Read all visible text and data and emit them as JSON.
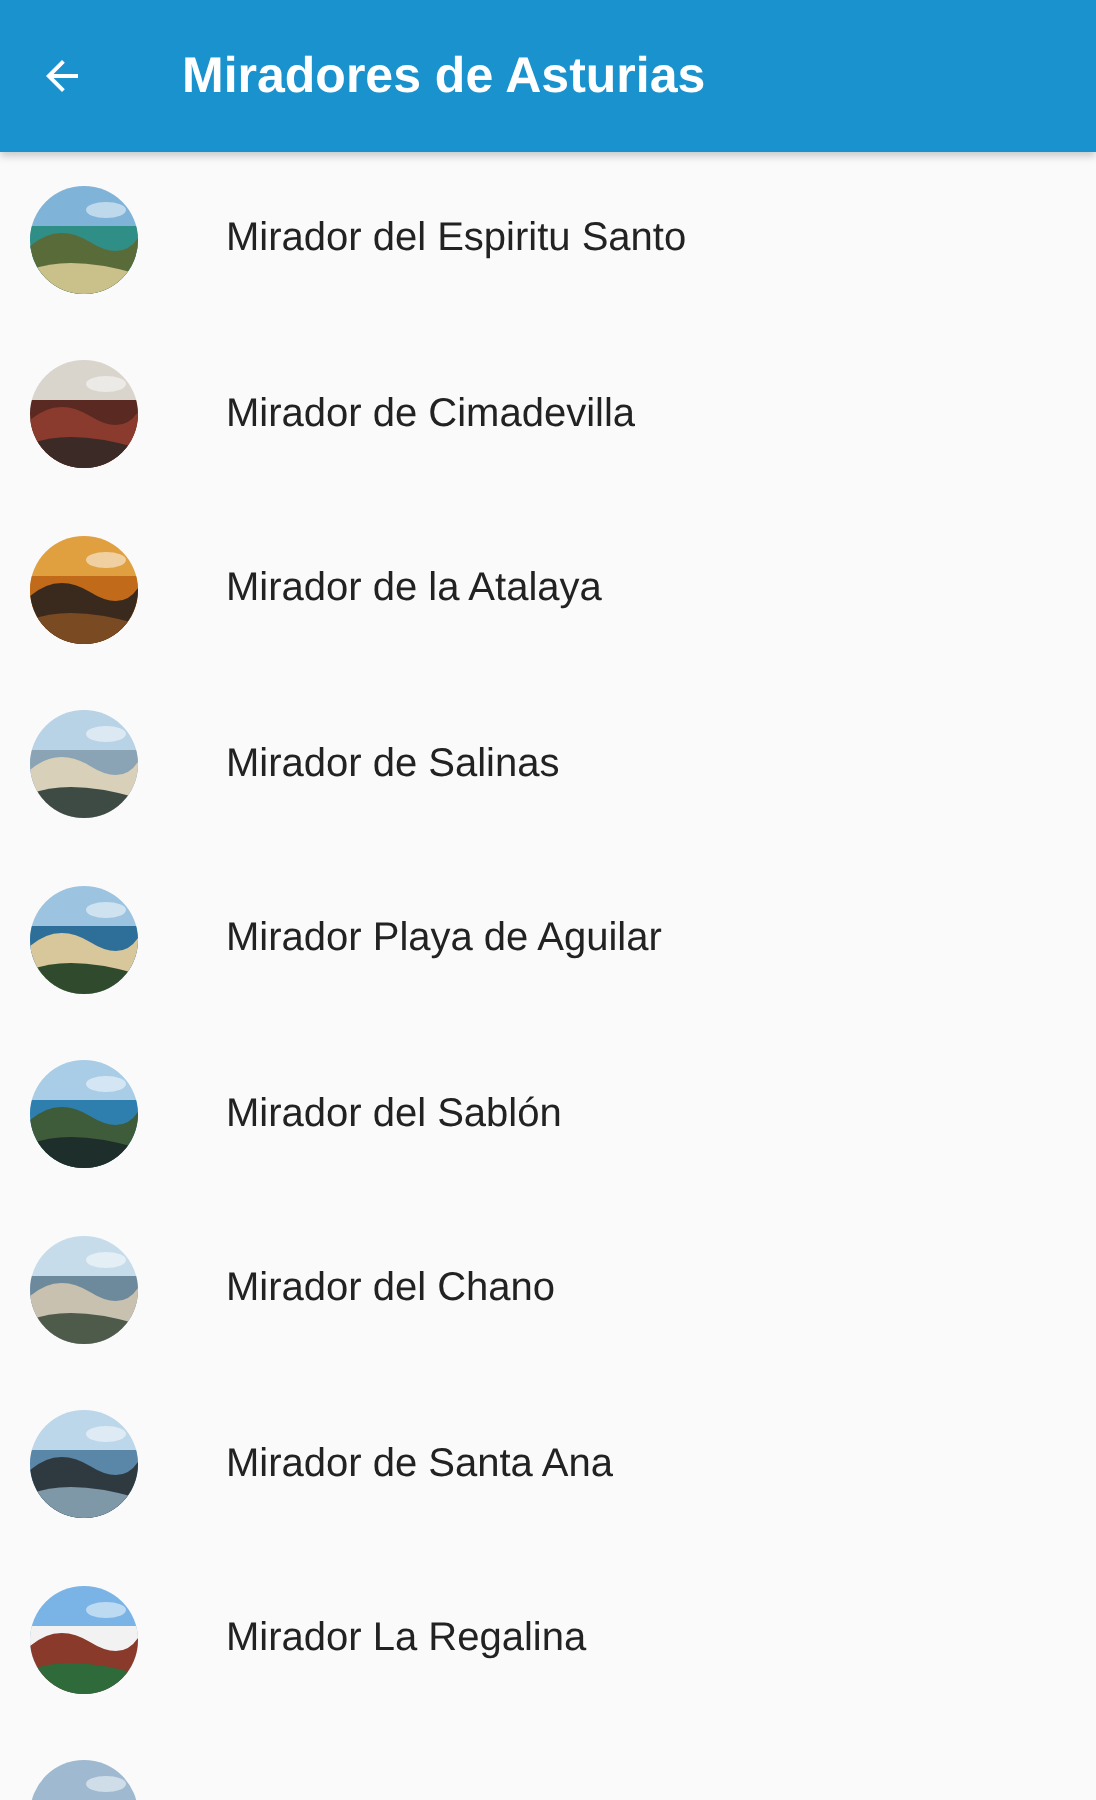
{
  "app_bar": {
    "title": "Miradores de Asturias"
  },
  "items": [
    {
      "label": "Mirador del Espiritu Santo",
      "thumbnail": {
        "kind": "picture"
      }
    },
    {
      "label": "Mirador de Cimadevilla",
      "thumbnail": {
        "kind": "picture"
      }
    },
    {
      "label": "Mirador de la Atalaya",
      "thumbnail": {
        "kind": "picture"
      }
    },
    {
      "label": "Mirador de Salinas",
      "thumbnail": {
        "kind": "picture"
      }
    },
    {
      "label": "Mirador Playa de Aguilar",
      "thumbnail": {
        "kind": "picture"
      }
    },
    {
      "label": "Mirador del Sablón",
      "thumbnail": {
        "kind": "picture"
      }
    },
    {
      "label": "Mirador del Chano",
      "thumbnail": {
        "kind": "picture"
      }
    },
    {
      "label": "Mirador de Santa Ana",
      "thumbnail": {
        "kind": "picture"
      }
    },
    {
      "label": "Mirador La Regalina",
      "thumbnail": {
        "kind": "picture"
      }
    },
    {
      "thumbnail": {
        "kind": "picture"
      }
    }
  ]
}
